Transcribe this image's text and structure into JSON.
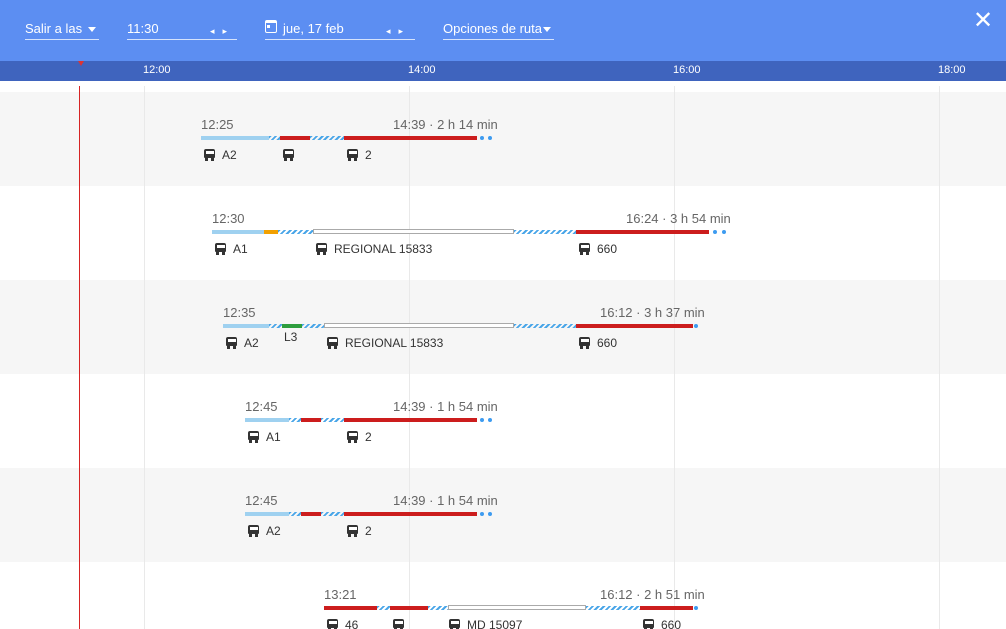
{
  "toolbar": {
    "depart_mode": "Salir a las",
    "time": "11:30",
    "date": "jue, 17 feb",
    "route_options": "Opciones de ruta",
    "close_glyph": "✕",
    "arrows": "◂▸"
  },
  "timeline": {
    "ticks": [
      "12:00",
      "14:00",
      "16:00",
      "18:00"
    ]
  },
  "itineraries": [
    {
      "start": "12:25",
      "end": "14:39 · 2 h 14 min",
      "labels": [
        "A2",
        "",
        "2"
      ]
    },
    {
      "start": "12:30",
      "end": "16:24 · 3 h 54 min",
      "labels": [
        "A1",
        "REGIONAL 15833",
        "660"
      ]
    },
    {
      "start": "12:35",
      "end": "16:12 · 3 h 37 min",
      "labels": [
        "A2",
        "L3",
        "REGIONAL 15833",
        "660"
      ]
    },
    {
      "start": "12:45",
      "end": "14:39 · 1 h 54 min",
      "labels": [
        "A1",
        "2"
      ]
    },
    {
      "start": "12:45",
      "end": "14:39 · 1 h 54 min",
      "labels": [
        "A2",
        "2"
      ]
    },
    {
      "start": "13:21",
      "end": "16:12 · 2 h 51 min",
      "labels": [
        "46",
        "",
        "MD 15097",
        "660"
      ]
    }
  ],
  "colors": {
    "header": "#5c8ef2",
    "axis": "#3f64be",
    "bus_red": "#cc1d1d",
    "walk_blue": "#4aa6e8",
    "local_blue": "#9fd1f0",
    "metro_orange": "#f2a000",
    "metro_green": "#2e9e3e",
    "now_line": "#d62424"
  },
  "icons": [
    "dropdown-caret-icon",
    "calendar-icon",
    "close-icon",
    "bus-icon",
    "train-icon"
  ]
}
